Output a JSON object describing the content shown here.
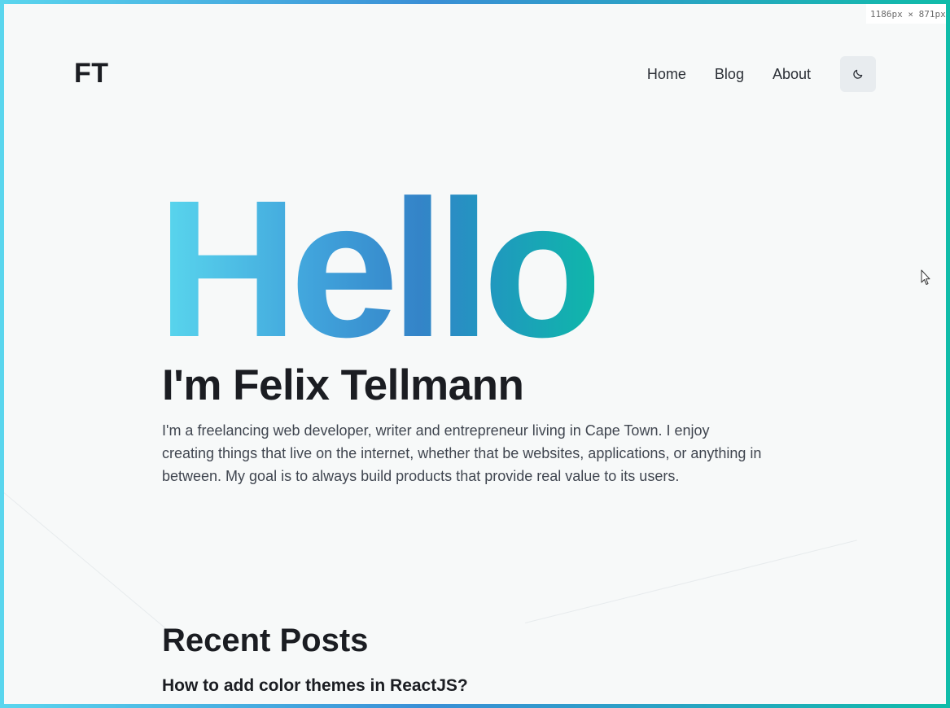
{
  "size_tag": "1186px × 871px",
  "brand": {
    "logo_text": "FT"
  },
  "nav": {
    "items": [
      {
        "label": "Home"
      },
      {
        "label": "Blog"
      },
      {
        "label": "About"
      }
    ],
    "theme_toggle_icon": "moon-icon"
  },
  "hero": {
    "greeting": "Hello",
    "name_line": "I'm Felix Tellmann",
    "bio": "I'm a freelancing web developer, writer and entrepreneur living in Cape Town. I enjoy creating things that live on the internet, whether that be websites, applications, or anything in between. My goal is to always build products that provide real value to its users."
  },
  "recent_posts": {
    "heading": "Recent Posts",
    "items": [
      {
        "title": "How to add color themes in ReactJS?"
      }
    ]
  },
  "colors": {
    "text_primary": "#1b1d22",
    "text_secondary": "#404650",
    "background": "#f7f9f9",
    "gradient_start": "#5ad8ee",
    "gradient_mid": "#3484c8",
    "gradient_end": "#0fb7aa",
    "toggle_bg": "#e8ecef"
  }
}
